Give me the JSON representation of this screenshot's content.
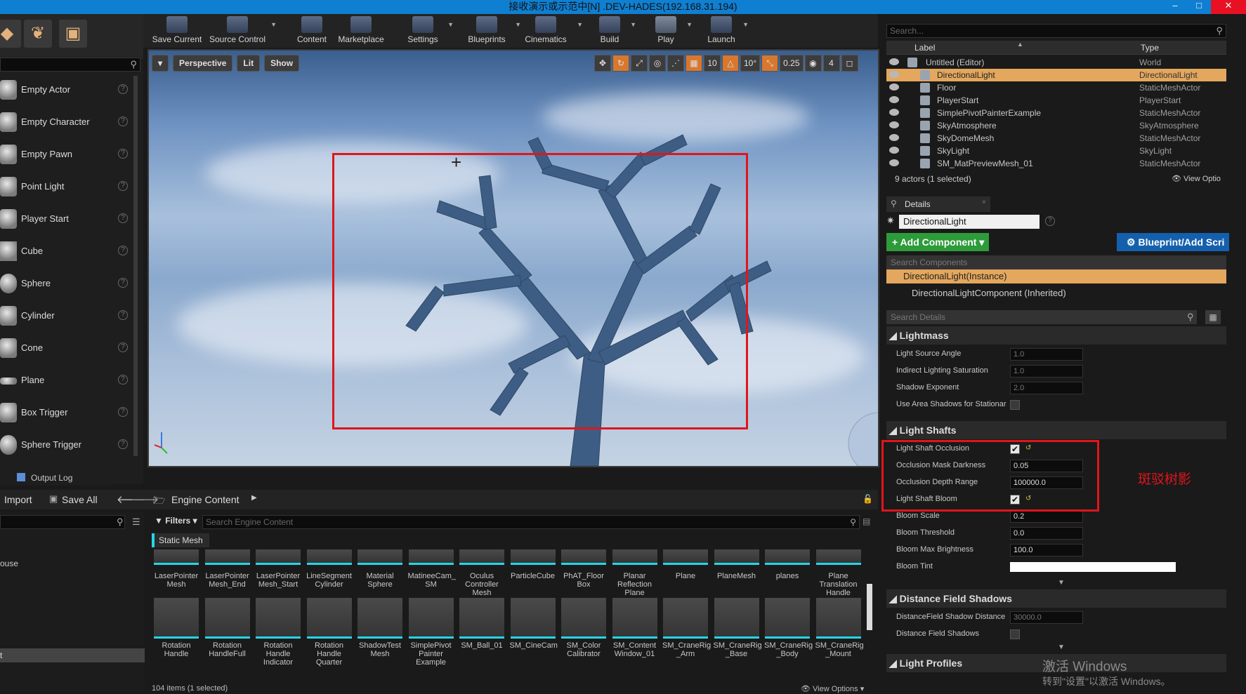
{
  "window": {
    "title": "接收演示或示范中[N] .DEV-HADES(192.168.31.194)"
  },
  "toolbar": {
    "items": [
      {
        "label": "Save Current"
      },
      {
        "label": "Source Control"
      },
      {
        "label": "Content"
      },
      {
        "label": "Marketplace"
      },
      {
        "label": "Settings"
      },
      {
        "label": "Blueprints"
      },
      {
        "label": "Cinematics"
      },
      {
        "label": "Build"
      },
      {
        "label": "Play"
      },
      {
        "label": "Launch"
      }
    ]
  },
  "place_panel": {
    "items": [
      {
        "label": "Empty Actor"
      },
      {
        "label": "Empty Character"
      },
      {
        "label": "Empty Pawn"
      },
      {
        "label": "Point Light"
      },
      {
        "label": "Player Start"
      },
      {
        "label": "Cube"
      },
      {
        "label": "Sphere"
      },
      {
        "label": "Cylinder"
      },
      {
        "label": "Cone"
      },
      {
        "label": "Plane"
      },
      {
        "label": "Box Trigger"
      },
      {
        "label": "Sphere Trigger"
      }
    ]
  },
  "viewport": {
    "perspective": "Perspective",
    "lit": "Lit",
    "show": "Show",
    "grid_snap": "10",
    "rot_snap": "10°",
    "scale_snap": "0.25",
    "cam_speed": "4"
  },
  "output_log": {
    "tab": "Output Log"
  },
  "content_browser": {
    "import": "Import",
    "save_all": "Save All",
    "path": "Engine Content",
    "filters": "Filters",
    "search_placeholder": "Search Engine Content",
    "active_filter": "Static Mesh",
    "status": "104 items (1 selected)",
    "view_options": "View Options",
    "left_item": "ouse",
    "left_item2": "t",
    "row1": [
      "LaserPointer Mesh",
      "LaserPointer Mesh_End",
      "LaserPointer Mesh_Start",
      "LineSegment Cylinder",
      "Material Sphere",
      "MatineeCam_ SM",
      "Oculus Controller Mesh",
      "ParticleCube",
      "PhAT_Floor Box",
      "Planar Reflection Plane",
      "Plane",
      "PlaneMesh",
      "planes",
      "Plane Translation Handle"
    ],
    "row2": [
      "Rotation Handle",
      "Rotation HandleFull",
      "Rotation Handle Indicator",
      "Rotation Handle Quarter",
      "ShadowTest Mesh",
      "SimplePivot Painter Example",
      "SM_Ball_01",
      "SM_CineCam",
      "SM_Color Calibrator",
      "SM_Content Window_01",
      "SM_CraneRig _Arm",
      "SM_CraneRig _Base",
      "SM_CraneRig _Body",
      "SM_CraneRig _Mount"
    ]
  },
  "outliner": {
    "search_placeholder": "Search...",
    "col_label": "Label",
    "col_type": "Type",
    "rows": [
      {
        "label": "Untitled (Editor)",
        "type": "World"
      },
      {
        "label": "DirectionalLight",
        "type": "DirectionalLight"
      },
      {
        "label": "Floor",
        "type": "StaticMeshActor"
      },
      {
        "label": "PlayerStart",
        "type": "PlayerStart"
      },
      {
        "label": "SimplePivotPainterExample",
        "type": "StaticMeshActor"
      },
      {
        "label": "SkyAtmosphere",
        "type": "SkyAtmosphere"
      },
      {
        "label": "SkyDomeMesh",
        "type": "StaticMeshActor"
      },
      {
        "label": "SkyLight",
        "type": "SkyLight"
      },
      {
        "label": "SM_MatPreviewMesh_01",
        "type": "StaticMeshActor"
      }
    ],
    "status": "9 actors (1 selected)",
    "view_options": "View Optio"
  },
  "details": {
    "tab": "Details",
    "name": "DirectionalLight",
    "add_component": "+ Add Component",
    "blueprint": "Blueprint/Add Scri",
    "search_components": "Search Components",
    "comp_instance": "DirectionalLight(Instance)",
    "comp_inherited": "DirectionalLightComponent (Inherited)",
    "search_details": "Search Details",
    "sections": {
      "lightmass": "Lightmass",
      "light_shafts": "Light Shafts",
      "distance_field_shadows": "Distance Field Shadows",
      "light_profiles": "Light Profiles"
    },
    "lightmass": [
      {
        "label": "Light Source Angle",
        "value": "1.0"
      },
      {
        "label": "Indirect Lighting Saturation",
        "value": "1.0"
      },
      {
        "label": "Shadow Exponent",
        "value": "2.0"
      },
      {
        "label": "Use Area Shadows for Stationar",
        "value": ""
      }
    ],
    "light_shafts": [
      {
        "label": "Light Shaft Occlusion",
        "value": ""
      },
      {
        "label": "Occlusion Mask Darkness",
        "value": "0.05"
      },
      {
        "label": "Occlusion Depth Range",
        "value": "100000.0"
      },
      {
        "label": "Light Shaft Bloom",
        "value": ""
      },
      {
        "label": "Bloom Scale",
        "value": "0.2"
      },
      {
        "label": "Bloom Threshold",
        "value": "0.0"
      },
      {
        "label": "Bloom Max Brightness",
        "value": "100.0"
      },
      {
        "label": "Bloom Tint",
        "value": ""
      }
    ],
    "dfs": [
      {
        "label": "DistanceField Shadow Distance",
        "value": "30000.0"
      },
      {
        "label": "Distance Field Shadows",
        "value": ""
      }
    ],
    "annotation": "斑驳树影"
  },
  "watermark": {
    "line1": "激活 Windows",
    "line2": "转到\"设置\"以激活 Windows。"
  }
}
